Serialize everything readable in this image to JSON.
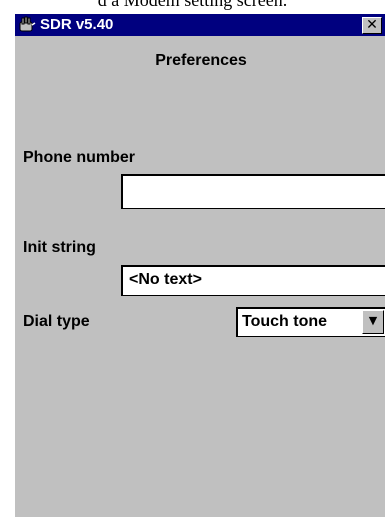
{
  "caption": "d a Modem setting screen.",
  "window": {
    "title": "SDR v5.40",
    "close_glyph": "✕"
  },
  "form": {
    "heading": "Preferences",
    "phone": {
      "label": "Phone number",
      "value": ""
    },
    "init": {
      "label": "Init string",
      "value": "<No text>"
    },
    "dial": {
      "label": "Dial type",
      "selected": "Touch tone"
    }
  },
  "icons": {
    "app": "app-hand-icon",
    "dropdown": "chevron-down-icon"
  }
}
